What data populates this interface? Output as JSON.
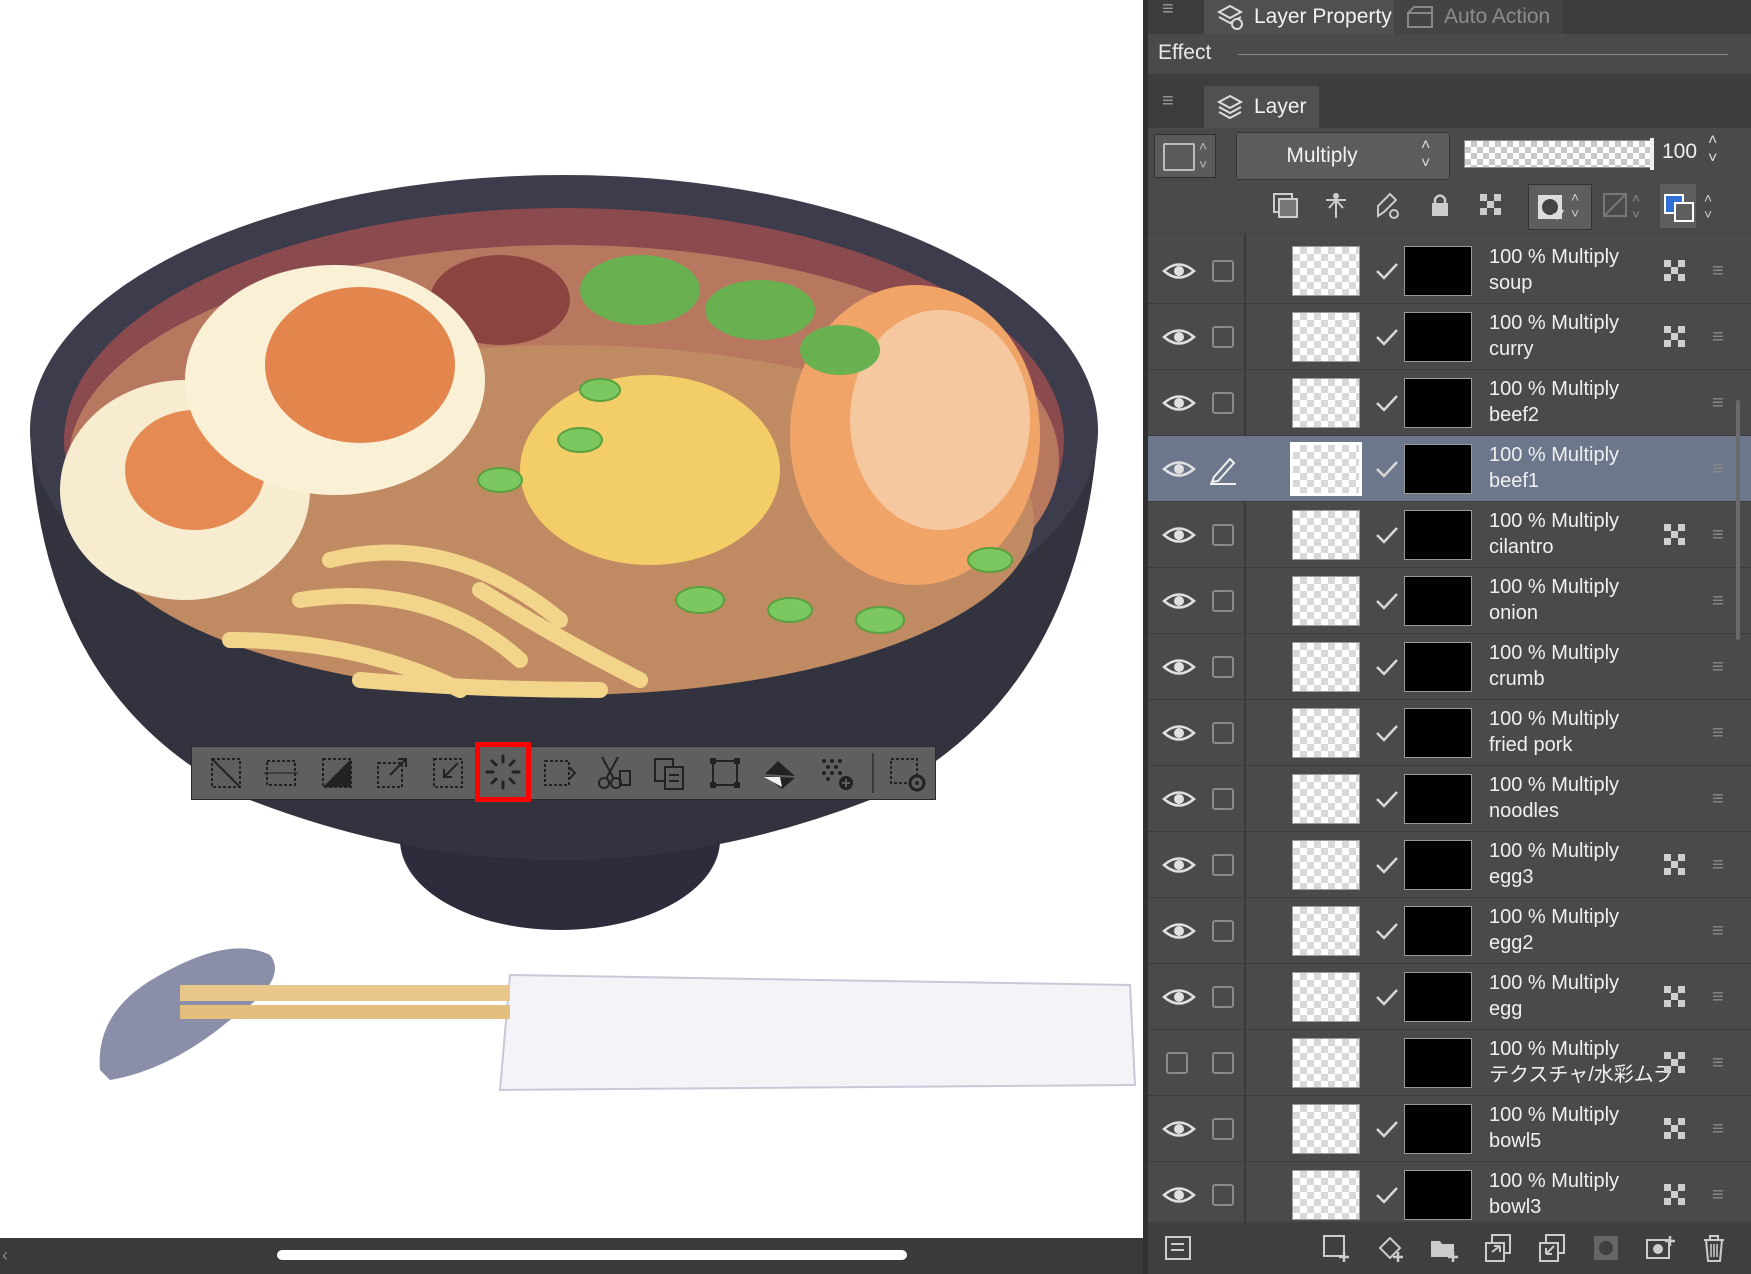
{
  "canvas": {
    "toolbar": {
      "buttons": [
        {
          "icon": "deselect-icon"
        },
        {
          "icon": "select-all-icon"
        },
        {
          "icon": "invert-selection-icon"
        },
        {
          "icon": "expand-selection-icon"
        },
        {
          "icon": "shrink-selection-icon"
        },
        {
          "icon": "selection-border-icon",
          "highlighted": true
        },
        {
          "icon": "move-selection-icon"
        },
        {
          "icon": "cut-paste-icon"
        },
        {
          "icon": "copy-paste-icon"
        },
        {
          "icon": "transform-icon"
        },
        {
          "icon": "fill-icon"
        },
        {
          "icon": "add-to-selection-icon"
        },
        {
          "icon": "selection-settings-icon"
        }
      ],
      "highlight_color": "#ff0000"
    }
  },
  "panel": {
    "top_tabs": {
      "layer_property": "Layer Property",
      "auto_action": "Auto Action"
    },
    "effect_label": "Effect",
    "layer_tab": "Layer",
    "blend_mode": "Multiply",
    "opacity": "100",
    "layers": [
      {
        "mode": "100 % Multiply",
        "name": "soup",
        "visible": true,
        "ref": true,
        "selected": false
      },
      {
        "mode": "100 % Multiply",
        "name": "curry",
        "visible": true,
        "ref": true,
        "selected": false
      },
      {
        "mode": "100 % Multiply",
        "name": "beef2",
        "visible": true,
        "ref": false,
        "selected": false
      },
      {
        "mode": "100 % Multiply",
        "name": "beef1",
        "visible": true,
        "ref": false,
        "selected": true
      },
      {
        "mode": "100 % Multiply",
        "name": "cilantro",
        "visible": true,
        "ref": true,
        "selected": false
      },
      {
        "mode": "100 % Multiply",
        "name": "onion",
        "visible": true,
        "ref": false,
        "selected": false
      },
      {
        "mode": "100 % Multiply",
        "name": "crumb",
        "visible": true,
        "ref": false,
        "selected": false
      },
      {
        "mode": "100 % Multiply",
        "name": "fried pork",
        "visible": true,
        "ref": false,
        "selected": false
      },
      {
        "mode": "100 % Multiply",
        "name": "noodles",
        "visible": true,
        "ref": false,
        "selected": false
      },
      {
        "mode": "100 % Multiply",
        "name": "egg3",
        "visible": true,
        "ref": true,
        "selected": false
      },
      {
        "mode": "100 % Multiply",
        "name": "egg2",
        "visible": true,
        "ref": false,
        "selected": false
      },
      {
        "mode": "100 % Multiply",
        "name": "egg",
        "visible": true,
        "ref": true,
        "selected": false
      },
      {
        "mode": "100 % Multiply",
        "name": "テクスチャ/水彩ムラ",
        "visible": false,
        "ref": true,
        "selected": false
      },
      {
        "mode": "100 % Multiply",
        "name": "bowl5",
        "visible": true,
        "ref": true,
        "selected": false
      },
      {
        "mode": "100 % Multiply",
        "name": "bowl3",
        "visible": true,
        "ref": true,
        "selected": false
      }
    ]
  },
  "colors": {
    "panel_bg": "#464646",
    "selected_row": "#6c778c",
    "foreground_color": "#2f6fd6"
  }
}
